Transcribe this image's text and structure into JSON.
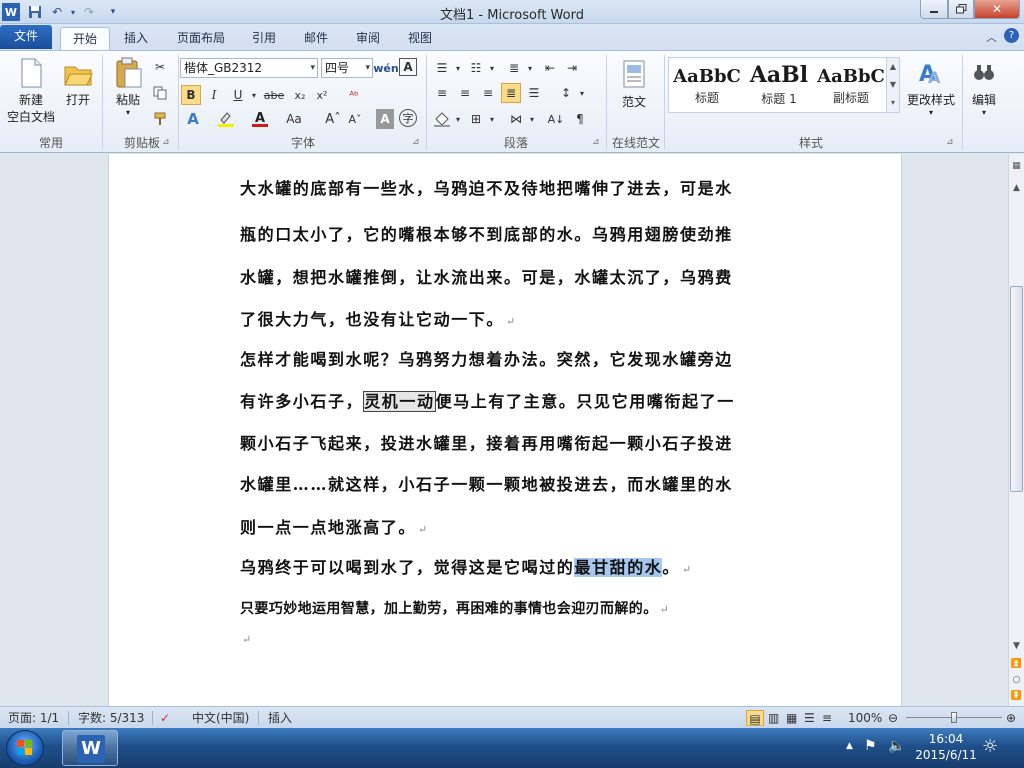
{
  "window": {
    "title": "文档1 - Microsoft Word"
  },
  "tabs": [
    {
      "label": "文件"
    },
    {
      "label": "开始"
    },
    {
      "label": "插入"
    },
    {
      "label": "页面布局"
    },
    {
      "label": "引用"
    },
    {
      "label": "邮件"
    },
    {
      "label": "审阅"
    },
    {
      "label": "视图"
    }
  ],
  "ribbon": {
    "common": {
      "new_line1": "新建",
      "new_line2": "空白文档",
      "open": "打开",
      "group": "常用"
    },
    "clipboard": {
      "paste": "粘贴",
      "group": "剪贴板"
    },
    "font": {
      "name": "楷体_GB2312",
      "size": "四号",
      "group": "字体"
    },
    "paragraph": {
      "group": "段落"
    },
    "online": {
      "sample": "范文",
      "group": "在线范文"
    },
    "styles": {
      "items": [
        {
          "preview": "AaBbC",
          "label": "标题"
        },
        {
          "preview": "AaBl",
          "label": "标题 1"
        },
        {
          "preview": "AaBbC",
          "label": "副标题"
        }
      ],
      "change": "更改样式",
      "group": "样式"
    },
    "editing": {
      "label": "编辑"
    }
  },
  "document": {
    "lines": [
      "大水罐的底部有一些水，乌鸦迫不及待地把嘴伸了进去，可是水",
      "瓶的口太小了，它的嘴根本够不到底部的水。乌鸦用翅膀使劲推",
      "水罐，想把水罐推倒，让水流出来。可是，水罐太沉了，乌鸦费",
      "了很大力气，也没有让它动一下。",
      "怎样才能喝到水呢？乌鸦努力想着办法。突然，它发现水罐旁边",
      "有许多小石子，",
      "灵机一动",
      "便马上有了主意。只见它用嘴衔起了一",
      "颗小石子飞起来，投进水罐里，接着再用嘴衔起一颗小石子投进",
      "水罐里……就这样，小石子一颗一颗地被投进去，而水罐里的水",
      "则一点一点地涨高了。",
      "乌鸦终于可以喝到水了，觉得这是它喝过的",
      "最甘甜的水",
      "。",
      "只要巧妙地运用智慧，加上勤劳，再困难的事情也会迎刃而解的。"
    ],
    "paragraph_mark": "↵"
  },
  "status": {
    "page": "页面: 1/1",
    "words": "字数: 5/313",
    "language": "中文(中国)",
    "mode": "插入",
    "zoom": "100%",
    "zoom_level": 1.0
  },
  "taskbar": {
    "time": "16:04",
    "date": "2015/6/11"
  },
  "colors": {
    "file_tab": "#2b63b3",
    "selection": "#a6c8ee",
    "accent": "#1f4f8a"
  }
}
